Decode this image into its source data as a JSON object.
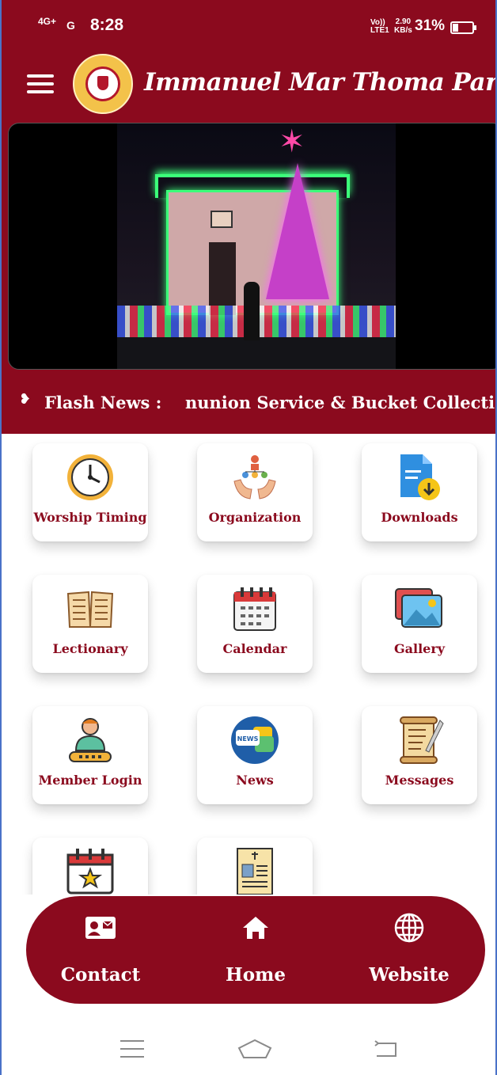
{
  "status_bar": {
    "network1": "4G+",
    "network2": "G",
    "time": "8:28",
    "volte": "Vo)) LTE1",
    "speed_value": "2.90",
    "speed_unit": "KB/s",
    "battery": "31%",
    "battery_level": 0.31
  },
  "app_bar": {
    "title": "Immanuel Mar Thoma Parish",
    "menu_icon": "hamburger-menu-icon",
    "logo_icon": "parish-seal-logo"
  },
  "banner": {
    "image": "church-christmas-lights-photo"
  },
  "flash_news": {
    "label": "Flash News :",
    "text": "nunion Service & Bucket Collection",
    "icon": "flash-icon"
  },
  "tiles": [
    {
      "label": "Worship Timing",
      "icon": "clock-icon"
    },
    {
      "label": "Organization",
      "icon": "organization-hands-icon"
    },
    {
      "label": "Downloads",
      "icon": "download-file-icon"
    },
    {
      "label": "Lectionary",
      "icon": "open-book-icon"
    },
    {
      "label": "Calendar",
      "icon": "calendar-icon"
    },
    {
      "label": "Gallery",
      "icon": "gallery-icon"
    },
    {
      "label": "Member Login",
      "icon": "member-user-icon"
    },
    {
      "label": "News",
      "icon": "news-icon"
    },
    {
      "label": "Messages",
      "icon": "scroll-quill-icon"
    },
    {
      "label": "",
      "icon": "event-calendar-star-icon"
    },
    {
      "label": "",
      "icon": "obituary-document-icon"
    }
  ],
  "bottom_nav": {
    "items": [
      {
        "label": "Contact",
        "icon": "contact-card-icon"
      },
      {
        "label": "Home",
        "icon": "home-icon"
      },
      {
        "label": "Website",
        "icon": "globe-icon"
      }
    ]
  },
  "colors": {
    "brand": "#8b0a1e",
    "tile_label": "#8b0a1e",
    "background": "#ffffff"
  }
}
